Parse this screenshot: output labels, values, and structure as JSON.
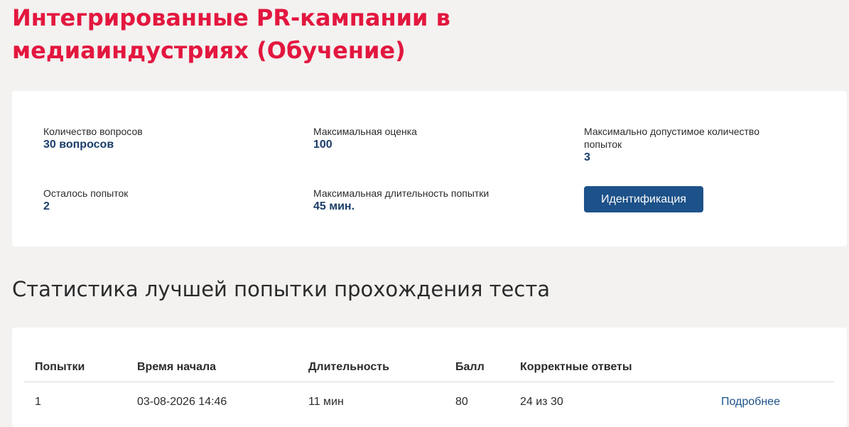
{
  "page": {
    "title": "Интегрированные PR-кампании в медиаиндустриях (Обучение)"
  },
  "info": {
    "questions_label": "Количество вопросов",
    "questions_value": "30 вопросов",
    "max_score_label": "Максимальная оценка",
    "max_score_value": "100",
    "max_attempts_label": "Максимально допустимое количество попыток",
    "max_attempts_value": "3",
    "attempts_left_label": "Осталось попыток",
    "attempts_left_value": "2",
    "max_duration_label": "Максимальная длительность попытки",
    "max_duration_value": "45 мин.",
    "ident_button_label": "Идентификация"
  },
  "stats": {
    "title": "Статистика лучшей попытки прохождения теста",
    "headers": {
      "attempts": "Попытки",
      "start_time": "Время начала",
      "duration": "Длительность",
      "score": "Балл",
      "correct": "Корректные ответы",
      "action": ""
    },
    "rows": [
      {
        "attempt": "1",
        "start_time": "03-08-2026 14:46",
        "duration": "11 мин",
        "score": "80",
        "correct": "24 из 30",
        "details_label": "Подробнее"
      }
    ]
  },
  "colors": {
    "accent_red": "#e3173f",
    "primary_blue": "#1c5189",
    "value_blue": "#1b3e6a",
    "background": "#f3f2f0"
  }
}
